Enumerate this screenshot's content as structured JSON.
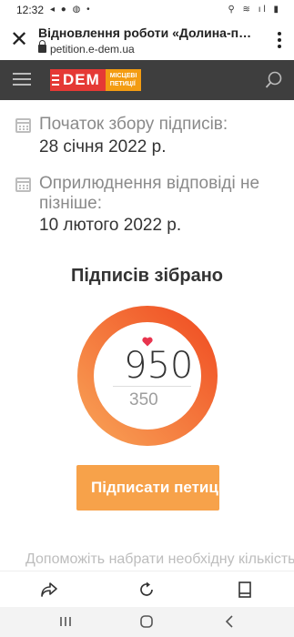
{
  "status": {
    "time": "12:32",
    "left_icons": "◂ ● ◍ •",
    "right_icons": "⚲ ≋ ıl ▮"
  },
  "browser": {
    "page_title": "Відновлення роботи «Долина-парк»",
    "url": "petition.e-dem.ua",
    "close_icon": "close-icon",
    "more_icon": "more-vertical-icon"
  },
  "site": {
    "logo_main": "DEM",
    "logo_sub_line1": "МІСЦЕВІ",
    "logo_sub_line2": "ПЕТИЦІЇ",
    "header_color": "#3e3e3e",
    "logo_red": "#e53935",
    "logo_orange": "#f39c12"
  },
  "petition": {
    "start_label": "Початок збору підписів:",
    "start_date": "28 січня 2022 р.",
    "response_label": "Оприлюднення відповіді не пізніше:",
    "response_date": "10 лютого 2022 р.",
    "signed_title": "Підписів зібрано",
    "signatures_count": "950",
    "signatures_goal": "350",
    "progress_fraction": 1.0,
    "sign_button": "Підписати петицію",
    "help_text": "Допоможіть набрати необхідну кількість підписів",
    "accent_color": "#f7a24a",
    "gauge_gradient": [
      "#f8a055",
      "#f04e23"
    ]
  },
  "bottom_nav": {
    "share_icon": "share-icon",
    "reload_icon": "reload-icon",
    "bookmark_icon": "bookmark-icon"
  },
  "system_nav": {
    "recents_icon": "recents-icon",
    "home_icon": "home-icon",
    "back_icon": "back-icon"
  }
}
